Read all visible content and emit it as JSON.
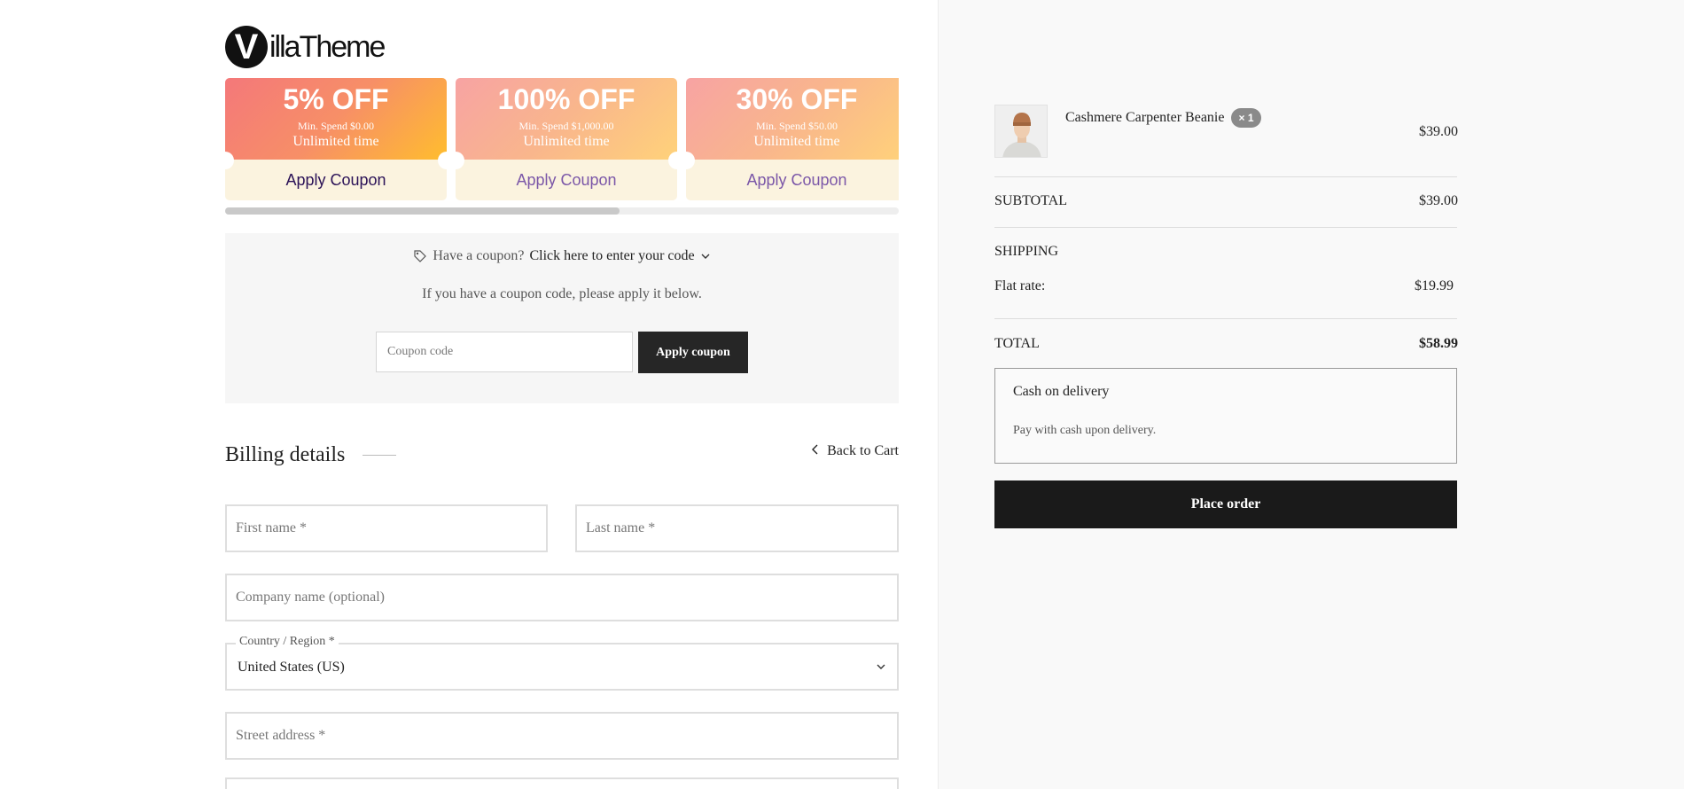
{
  "brand": {
    "mark": "V",
    "name": "illaTheme"
  },
  "coupons": [
    {
      "off": "5% OFF",
      "min_spend": "Min. Spend $0.00",
      "time": "Unlimited time",
      "action": "Apply Coupon"
    },
    {
      "off": "100% OFF",
      "min_spend": "Min. Spend $1,000.00",
      "time": "Unlimited time",
      "action": "Apply Coupon"
    },
    {
      "off": "30% OFF",
      "min_spend": "Min. Spend $50.00",
      "time": "Unlimited time",
      "action": "Apply Coupon"
    }
  ],
  "coupon_form": {
    "prompt": "Have a coupon?",
    "link": "Click here to enter your code",
    "hint": "If you have a coupon code, please apply it below.",
    "placeholder": "Coupon code",
    "apply_label": "Apply coupon"
  },
  "billing": {
    "title": "Billing details",
    "back_label": "Back to Cart",
    "first_name_placeholder": "First name *",
    "last_name_placeholder": "Last name *",
    "company_placeholder": "Company name (optional)",
    "country_label": "Country / Region *",
    "country_value": "United States (US)",
    "street_placeholder": "Street address *"
  },
  "order": {
    "product": {
      "name": "Cashmere Carpenter Beanie",
      "qty": "× 1",
      "price": "$39.00"
    },
    "subtotal_label": "SUBTOTAL",
    "subtotal_value": "$39.00",
    "shipping_label": "SHIPPING",
    "shipping_method": "Flat rate:",
    "shipping_value": "$19.99",
    "total_label": "TOTAL",
    "total_value": "$58.99",
    "payment": {
      "title": "Cash on delivery",
      "description": "Pay with cash upon delivery."
    },
    "place_order_label": "Place order"
  },
  "colors": {
    "accent_dark": "#1a1a1a",
    "coupon_text": "#7b57a8",
    "page_bg_right": "#f9f9f9"
  }
}
